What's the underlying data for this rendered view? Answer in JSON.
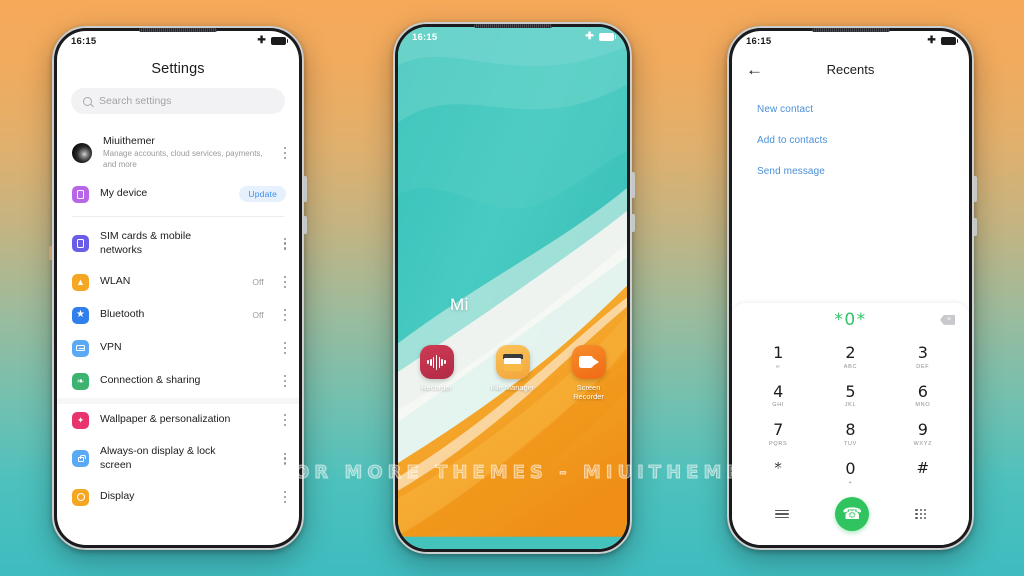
{
  "background": {
    "top_color": "#f7a95a",
    "bottom_color": "#3fbcc0"
  },
  "watermark": {
    "text": "VISIT  FOR  MORE  THEMES  -  MIUITHEMER.COM"
  },
  "phones": {
    "left": {
      "status_bar": {
        "time": "16:15",
        "airplane_icon": "airplane-icon",
        "battery_icon": "battery-icon"
      },
      "screen": {
        "title": "Settings",
        "search": {
          "placeholder": "Search settings",
          "icon": "search-icon"
        },
        "account": {
          "name": "Miuithemer",
          "subtitle": "Manage accounts, cloud services, payments, and more",
          "avatar": "avatar",
          "overflow": "more-options-icon"
        },
        "items": [
          {
            "label": "My device",
            "icon": "device-icon",
            "color": "#b866e8",
            "badge": "Update",
            "value": "",
            "overflow": false,
            "glyph": "box"
          },
          {
            "label": "SIM cards & mobile networks",
            "icon": "sim-icon",
            "color": "#6b5ce7",
            "badge": "",
            "value": "",
            "overflow": true,
            "glyph": "box"
          },
          {
            "label": "WLAN",
            "icon": "wifi-icon",
            "color": "#f5a623",
            "badge": "",
            "value": "Off",
            "overflow": true,
            "glyph": "wifi"
          },
          {
            "label": "Bluetooth",
            "icon": "bluetooth-icon",
            "color": "#2f80ed",
            "badge": "",
            "value": "Off",
            "overflow": true,
            "glyph": "bt"
          },
          {
            "label": "VPN",
            "icon": "vpn-icon",
            "color": "#5aa9f5",
            "badge": "",
            "value": "",
            "overflow": true,
            "glyph": "vpn"
          },
          {
            "label": "Connection & sharing",
            "icon": "share-icon",
            "color": "#3cb371",
            "badge": "",
            "value": "",
            "overflow": true,
            "glyph": "share"
          },
          {
            "label": "Wallpaper & personalization",
            "icon": "wallpaper-icon",
            "color": "#e8336d",
            "badge": "",
            "value": "",
            "overflow": true,
            "glyph": "brush"
          },
          {
            "label": "Always-on display & lock screen",
            "icon": "lock-icon",
            "color": "#5aa9f5",
            "badge": "",
            "value": "",
            "overflow": true,
            "glyph": "lock"
          },
          {
            "label": "Display",
            "icon": "display-icon",
            "color": "#f5a623",
            "badge": "",
            "value": "",
            "overflow": true,
            "glyph": "circle"
          }
        ]
      }
    },
    "center": {
      "status_bar": {
        "time": "16:15",
        "airplane_icon": "airplane-icon",
        "battery_icon": "battery-icon"
      },
      "screen": {
        "widget_text": "Mi",
        "wallpaper": {
          "name": "beach-shore-wallpaper",
          "water": "#3fc2ba",
          "foam": "#eef2ee",
          "sand": "#f5a623"
        },
        "apps": [
          {
            "label": "Recorder",
            "icon": "recorder-icon",
            "color": "#c63350"
          },
          {
            "label": "File Manager",
            "icon": "file-manager-icon",
            "color": "#f6b248"
          },
          {
            "label": "Screen Recorder",
            "icon": "screen-recorder-icon",
            "color": "#f27a1e"
          }
        ]
      }
    },
    "right": {
      "status_bar": {
        "time": "16:15",
        "airplane_icon": "airplane-icon",
        "battery_icon": "battery-icon"
      },
      "screen": {
        "back_icon": "back-arrow-icon",
        "title": "Recents",
        "links": [
          "New contact",
          "Add to contacts",
          "Send message"
        ],
        "dialer": {
          "number": "*0*",
          "number_color": "#35c26a",
          "backspace_icon": "backspace-icon",
          "keys": [
            {
              "digit": "1",
              "letters": "∞"
            },
            {
              "digit": "2",
              "letters": "ABC"
            },
            {
              "digit": "3",
              "letters": "DEF"
            },
            {
              "digit": "4",
              "letters": "GHI"
            },
            {
              "digit": "5",
              "letters": "JKL"
            },
            {
              "digit": "6",
              "letters": "MNO"
            },
            {
              "digit": "7",
              "letters": "PQRS"
            },
            {
              "digit": "8",
              "letters": "TUV"
            },
            {
              "digit": "9",
              "letters": "WXYZ"
            },
            {
              "digit": "*",
              "letters": ""
            },
            {
              "digit": "0",
              "letters": "+"
            },
            {
              "digit": "#",
              "letters": ""
            }
          ],
          "actions": {
            "menu_icon": "menu-icon",
            "call_icon": "call-icon",
            "keypad_icon": "keypad-grid-icon"
          }
        }
      }
    }
  }
}
